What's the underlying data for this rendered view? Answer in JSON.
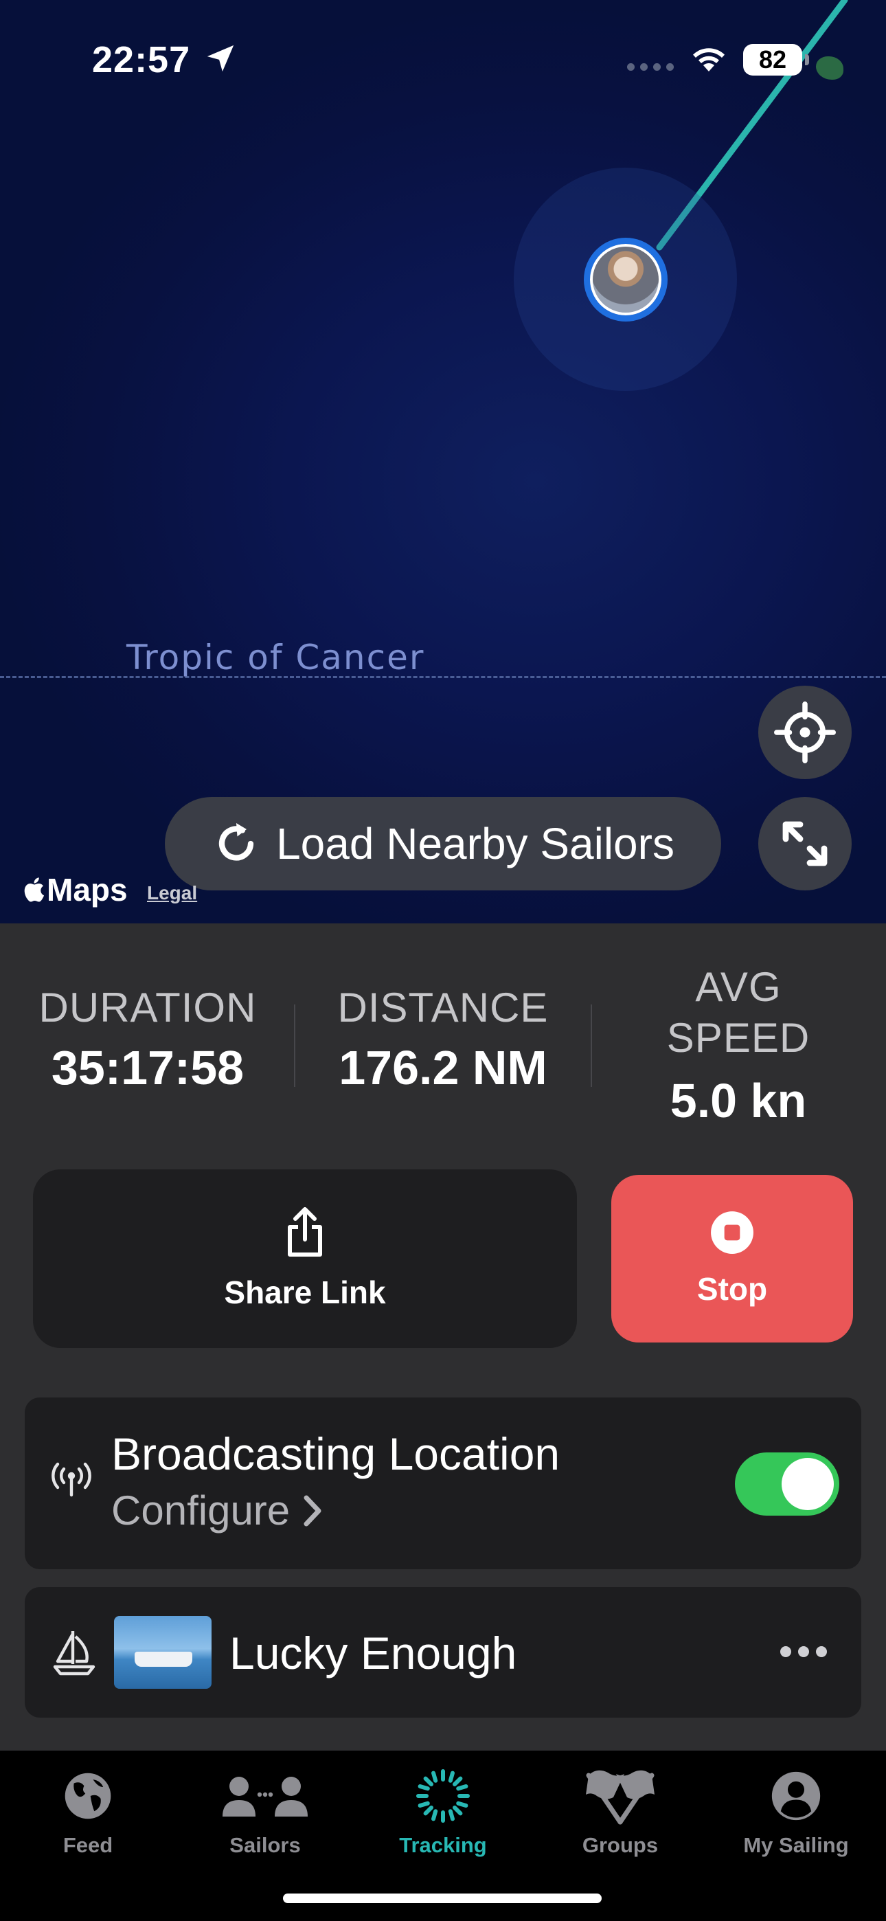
{
  "status_bar": {
    "time": "22:57",
    "battery": "82"
  },
  "map": {
    "tropic_label": "Tropic of Cancer",
    "load_nearby_label": "Load Nearby Sailors",
    "maps_logo_text": "Maps",
    "legal_link": "Legal",
    "route_color": "#2bb5ad"
  },
  "stats": {
    "duration": {
      "label": "DURATION",
      "value": "35:17:58"
    },
    "distance": {
      "label": "DISTANCE",
      "value": "176.2 NM"
    },
    "avg_speed": {
      "label_line1": "AVG",
      "label_line2": "SPEED",
      "value": "5.0 kn"
    }
  },
  "actions": {
    "share_label": "Share Link",
    "stop_label": "Stop",
    "stop_color": "#ea5657"
  },
  "broadcast": {
    "title": "Broadcasting Location",
    "configure_label": "Configure",
    "enabled": true
  },
  "boat": {
    "name": "Lucky Enough"
  },
  "tabs": [
    {
      "label": "Feed",
      "icon": "globe-icon"
    },
    {
      "label": "Sailors",
      "icon": "people-icon"
    },
    {
      "label": "Tracking",
      "icon": "tracking-icon",
      "active": true
    },
    {
      "label": "Groups",
      "icon": "flags-icon"
    },
    {
      "label": "My Sailing",
      "icon": "person-circle-icon"
    }
  ],
  "colors": {
    "accent": "#28b8b4",
    "toggle_on": "#35c759"
  }
}
